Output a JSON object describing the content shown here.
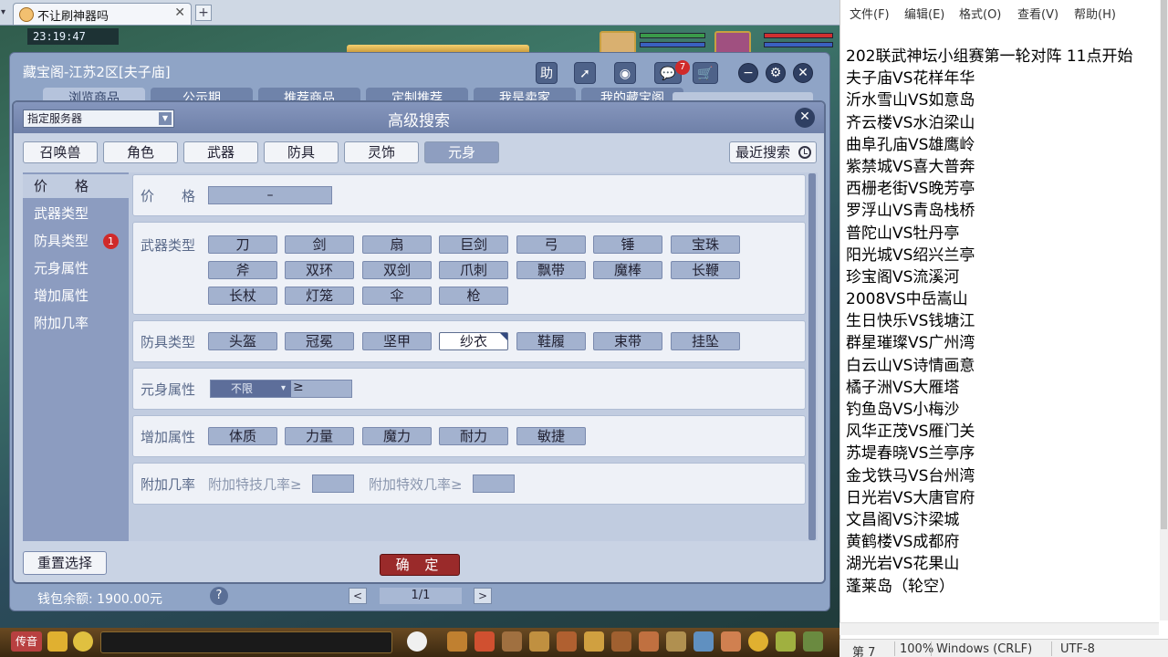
{
  "browser": {
    "tab_title": "不让刷神器吗",
    "close_glyph": "✕",
    "new_tab_glyph": "+"
  },
  "game": {
    "clock": "23:19:47"
  },
  "main_window": {
    "title": "藏宝阁-江苏2区[夫子庙]",
    "icons": {
      "help": "助",
      "share": "➚",
      "stop": "◉",
      "chat": "💬",
      "cart": "🛒",
      "minimize": "−",
      "settings": "⚙",
      "close": "✕"
    },
    "message_badge": "7",
    "tabs": [
      "浏览商品",
      "公示期",
      "推荐商品",
      "定制推荐",
      "我是卖家",
      "我的藏宝阁"
    ],
    "wallet": "钱包余额: 1900.00元",
    "help_glyph": "?",
    "pagination": {
      "prev": "<",
      "page": "1/1",
      "next": ">"
    }
  },
  "advanced_search": {
    "server_select": "指定服务器",
    "title": "高级搜索",
    "close_glyph": "✕",
    "categories": [
      "召唤兽",
      "角色",
      "武器",
      "防具",
      "灵饰",
      "元身"
    ],
    "active_category": "元身",
    "recent_search": "最近搜索",
    "sidebar": [
      "价　　格",
      "武器类型",
      "防具类型",
      "元身属性",
      "增加属性",
      "附加几率"
    ],
    "sidebar_badge": "1",
    "price": {
      "label": "价　　格",
      "dash": "–"
    },
    "weapon_types": {
      "label": "武器类型",
      "items": [
        "刀",
        "剑",
        "扇",
        "巨剑",
        "弓",
        "锤",
        "宝珠",
        "斧",
        "双环",
        "双剑",
        "爪刺",
        "飘带",
        "魔棒",
        "长鞭",
        "长杖",
        "灯笼",
        "伞",
        "枪"
      ]
    },
    "armor_types": {
      "label": "防具类型",
      "items": [
        "头盔",
        "冠冕",
        "坚甲",
        "纱衣",
        "鞋履",
        "束带",
        "挂坠"
      ],
      "selected": "纱衣"
    },
    "yuanshen_attr": {
      "label": "元身属性",
      "select_value": "不限",
      "ge": "≥"
    },
    "add_attr": {
      "label": "增加属性",
      "items": [
        "体质",
        "力量",
        "魔力",
        "耐力",
        "敏捷"
      ]
    },
    "extra_rate": {
      "label": "附加几率",
      "skill_label": "附加特技几率≥",
      "effect_label": "附加特效几率≥"
    },
    "reset_button": "重置选择",
    "confirm_button": "确 定"
  },
  "taskbar": {
    "chuanyin": "传音"
  },
  "notepad": {
    "menu": [
      "文件(F)",
      "编辑(E)",
      "格式(O)",
      "查看(V)",
      "帮助(H)"
    ],
    "lines": [
      "202联武神坛小组赛第一轮对阵 11点开始",
      "夫子庙VS花样年华",
      "沂水雪山VS如意岛",
      "齐云楼VS水泊梁山",
      "曲阜孔庙VS雄鹰岭",
      "紫禁城VS喜大普奔",
      "西栅老街VS晚芳亭",
      "罗浮山VS青岛栈桥",
      "普陀山VS牡丹亭",
      "阳光城VS绍兴兰亭",
      "珍宝阁VS流溪河",
      "2008VS中岳嵩山",
      "生日快乐VS钱塘江",
      "群星璀璨VS广州湾",
      "白云山VS诗情画意",
      "橘子洲VS大雁塔",
      "钓鱼岛VS小梅沙",
      "风华正茂VS雁门关",
      "苏堤春晓VS兰亭序",
      "金戈铁马VS台州湾",
      "日光岩VS大唐官府",
      "文昌阁VS汴梁城",
      "黄鹤楼VS成都府",
      "湖光岩VS花果山",
      "蓬莱岛（轮空）"
    ],
    "status": {
      "line": "第 7",
      "zoom": "100%",
      "eol": "Windows (CRLF)",
      "encoding": "UTF-8"
    }
  }
}
